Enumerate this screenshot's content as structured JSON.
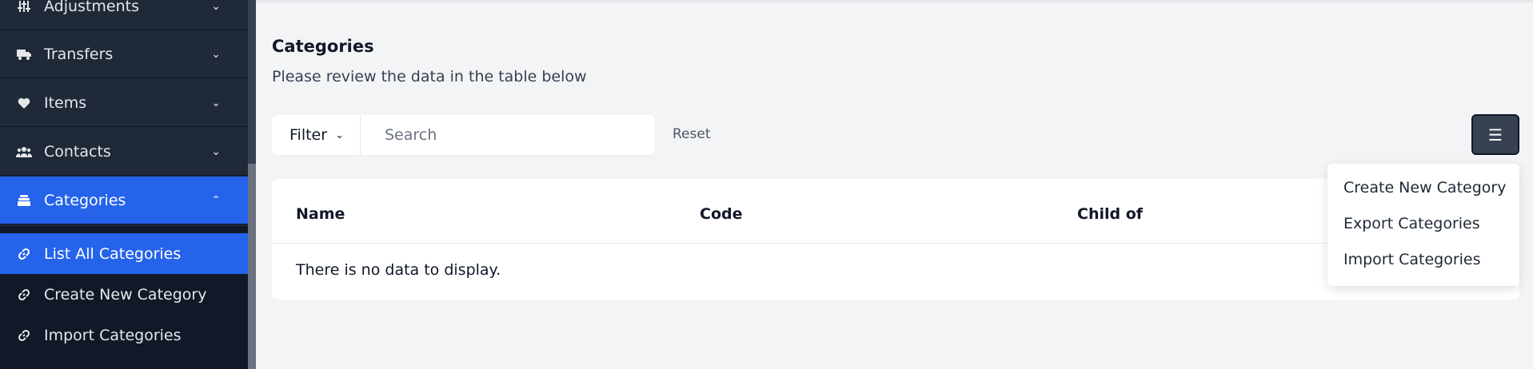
{
  "sidebar": {
    "items": [
      {
        "label": "Adjustments",
        "icon": "sliders-icon"
      },
      {
        "label": "Transfers",
        "icon": "truck-icon"
      },
      {
        "label": "Items",
        "icon": "heart-icon"
      },
      {
        "label": "Contacts",
        "icon": "users-icon"
      },
      {
        "label": "Categories",
        "icon": "layers-icon"
      }
    ],
    "sub_items": [
      {
        "label": "List All Categories",
        "icon": "link-icon"
      },
      {
        "label": "Create New Category",
        "icon": "link-icon"
      },
      {
        "label": "Import Categories",
        "icon": "link-icon"
      }
    ]
  },
  "main": {
    "title": "Categories",
    "subtitle": "Please review the data in the table below",
    "filter_label": "Filter",
    "search_placeholder": "Search",
    "reset_label": "Reset",
    "table": {
      "columns": [
        "Name",
        "Code",
        "Child of"
      ],
      "empty_message": "There is no data to display."
    },
    "dropdown": {
      "items": [
        "Create New Category",
        "Export Categories",
        "Import Categories"
      ]
    }
  },
  "colors": {
    "sidebar_bg": "#1f2937",
    "active": "#2563eb",
    "page_bg": "#f3f4f6"
  }
}
